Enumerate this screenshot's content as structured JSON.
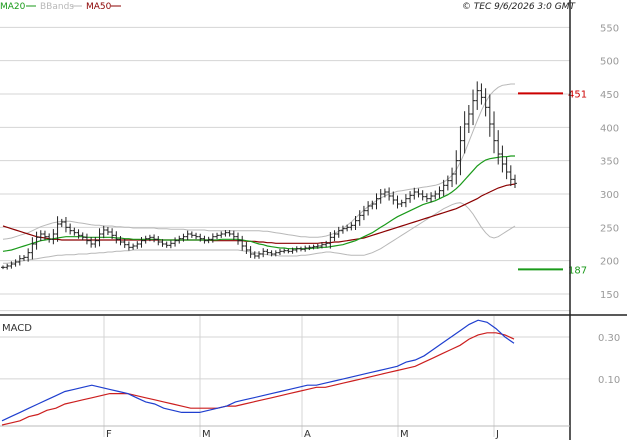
{
  "header": {
    "legend": [
      {
        "key": "ma20",
        "label": "MA20",
        "color": "#1a9a1a"
      },
      {
        "key": "bb",
        "label": "BBands",
        "color": "#b8b8b8"
      },
      {
        "key": "ma50",
        "label": "MA50",
        "color": "#8b0000"
      }
    ],
    "copyright": "© TEC 9/6/2026 3:0 GMT"
  },
  "colors": {
    "price": "#222222",
    "ma20": "#1a9a1a",
    "ma50": "#8b0000",
    "bb": "#b8b8b8",
    "grid": "#d4d4d4",
    "macd": "#1f3fcf",
    "signal": "#cc1f1f",
    "resistance": "#cc0000",
    "support": "#1a9a1a"
  },
  "chart_data": [
    {
      "type": "ohlc",
      "ylim": [
        120,
        570
      ],
      "yticks": [
        150,
        200,
        250,
        300,
        350,
        400,
        450,
        500,
        550
      ],
      "xlabels": [
        "F",
        "M",
        "A",
        "M",
        "J"
      ],
      "levels": [
        {
          "name": "resistance",
          "value": 451,
          "label": "451"
        },
        {
          "name": "support",
          "value": 187,
          "label": "187"
        }
      ],
      "closes": [
        190,
        192,
        195,
        198,
        203,
        205,
        212,
        225,
        235,
        240,
        236,
        232,
        240,
        255,
        258,
        250,
        245,
        242,
        238,
        235,
        230,
        225,
        230,
        240,
        246,
        243,
        238,
        232,
        228,
        224,
        220,
        222,
        225,
        230,
        233,
        235,
        232,
        228,
        225,
        223,
        226,
        230,
        233,
        236,
        240,
        238,
        236,
        233,
        230,
        232,
        236,
        238,
        240,
        242,
        240,
        236,
        230,
        222,
        216,
        210,
        207,
        210,
        214,
        212,
        210,
        212,
        214,
        215,
        214,
        216,
        218,
        217,
        219,
        220,
        221,
        222,
        224,
        226,
        235,
        240,
        245,
        248,
        250,
        253,
        260,
        268,
        275,
        282,
        285,
        293,
        300,
        303,
        297,
        291,
        285,
        287,
        293,
        298,
        303,
        300,
        296,
        293,
        297,
        300,
        305,
        313,
        320,
        330,
        350,
        380,
        405,
        420,
        440,
        455,
        445,
        430,
        405,
        380,
        360,
        345,
        333,
        322,
        316
      ],
      "ma20": [
        214,
        215,
        216,
        218,
        220,
        222,
        224,
        226,
        228,
        230,
        231,
        232,
        233,
        234,
        235,
        236,
        236,
        236,
        236,
        236,
        235,
        235,
        235,
        235,
        235,
        235,
        235,
        234,
        234,
        233,
        233,
        232,
        232,
        232,
        232,
        232,
        232,
        232,
        231,
        231,
        231,
        231,
        231,
        231,
        231,
        231,
        231,
        231,
        231,
        231,
        231,
        231,
        232,
        232,
        232,
        232,
        232,
        231,
        230,
        229,
        227,
        225,
        224,
        222,
        221,
        220,
        219,
        219,
        218,
        218,
        218,
        218,
        218,
        218,
        219,
        219,
        220,
        220,
        221,
        222,
        223,
        224,
        226,
        228,
        230,
        233,
        236,
        239,
        242,
        246,
        250,
        254,
        258,
        262,
        266,
        269,
        272,
        275,
        278,
        281,
        284,
        286,
        288,
        290,
        293,
        296,
        299,
        303,
        308,
        314,
        321,
        328,
        335,
        342,
        347,
        351,
        353,
        354,
        355,
        356,
        356,
        357,
        357
      ],
      "ma50": [
        252,
        250,
        248,
        246,
        244,
        242,
        240,
        238,
        236,
        235,
        234,
        233,
        232,
        232,
        231,
        231,
        231,
        231,
        231,
        231,
        231,
        231,
        231,
        231,
        231,
        231,
        231,
        231,
        231,
        231,
        231,
        231,
        231,
        231,
        231,
        231,
        231,
        231,
        231,
        231,
        231,
        231,
        231,
        231,
        231,
        231,
        231,
        231,
        231,
        231,
        230,
        230,
        230,
        230,
        230,
        230,
        230,
        230,
        229,
        229,
        229,
        228,
        228,
        227,
        227,
        226,
        226,
        226,
        226,
        226,
        226,
        226,
        226,
        226,
        226,
        226,
        227,
        227,
        227,
        228,
        228,
        229,
        230,
        231,
        232,
        233,
        234,
        236,
        238,
        240,
        242,
        244,
        246,
        248,
        250,
        252,
        254,
        256,
        258,
        260,
        262,
        264,
        266,
        268,
        270,
        272,
        274,
        276,
        278,
        281,
        284,
        287,
        290,
        293,
        297,
        300,
        303,
        306,
        309,
        311,
        313,
        314,
        315
      ],
      "bb_upper": [
        232,
        233,
        234,
        236,
        238,
        240,
        242,
        245,
        248,
        251,
        253,
        255,
        257,
        258,
        259,
        259,
        259,
        258,
        257,
        256,
        255,
        254,
        253,
        253,
        252,
        252,
        252,
        251,
        251,
        250,
        250,
        249,
        249,
        249,
        249,
        249,
        249,
        248,
        248,
        248,
        247,
        247,
        247,
        247,
        246,
        246,
        246,
        246,
        246,
        245,
        245,
        245,
        245,
        245,
        245,
        245,
        245,
        245,
        245,
        245,
        245,
        245,
        244,
        244,
        243,
        242,
        241,
        240,
        239,
        238,
        237,
        236,
        236,
        235,
        235,
        235,
        236,
        237,
        239,
        241,
        244,
        248,
        253,
        258,
        264,
        270,
        276,
        281,
        286,
        290,
        294,
        297,
        300,
        302,
        304,
        305,
        306,
        307,
        308,
        309,
        310,
        311,
        312,
        313,
        315,
        318,
        322,
        328,
        336,
        348,
        362,
        378,
        394,
        410,
        425,
        438,
        448,
        455,
        460,
        463,
        464,
        465,
        465
      ],
      "bb_lower": [
        196,
        196,
        197,
        198,
        199,
        200,
        201,
        202,
        203,
        204,
        205,
        206,
        207,
        208,
        208,
        209,
        209,
        209,
        210,
        210,
        210,
        211,
        211,
        212,
        212,
        213,
        213,
        214,
        214,
        215,
        215,
        216,
        216,
        216,
        216,
        216,
        216,
        216,
        216,
        216,
        216,
        216,
        216,
        216,
        216,
        216,
        216,
        216,
        216,
        216,
        216,
        216,
        216,
        216,
        216,
        216,
        216,
        215,
        214,
        213,
        212,
        211,
        210,
        209,
        208,
        208,
        207,
        207,
        207,
        207,
        207,
        208,
        208,
        209,
        210,
        211,
        212,
        213,
        213,
        212,
        211,
        210,
        209,
        208,
        208,
        208,
        208,
        210,
        212,
        215,
        218,
        222,
        226,
        230,
        234,
        238,
        242,
        246,
        250,
        254,
        258,
        262,
        266,
        270,
        274,
        278,
        281,
        284,
        286,
        287,
        284,
        278,
        270,
        260,
        250,
        242,
        236,
        234,
        236,
        240,
        244,
        248,
        252
      ]
    },
    {
      "type": "line",
      "title": "MACD",
      "ylim": [
        -12,
        40
      ],
      "yticks": [
        10,
        30
      ],
      "ytick_labels": [
        "0.10",
        "0.30"
      ],
      "series": [
        {
          "name": "macd",
          "values": [
            -10,
            -8,
            -6,
            -4,
            -2,
            0,
            2,
            4,
            5,
            6,
            7,
            6,
            5,
            4,
            3,
            1,
            -1,
            -2,
            -4,
            -5,
            -6,
            -6,
            -6,
            -5,
            -4,
            -3,
            -1,
            0,
            1,
            2,
            3,
            4,
            5,
            6,
            7,
            7,
            8,
            9,
            10,
            11,
            12,
            13,
            14,
            15,
            16,
            18,
            19,
            21,
            24,
            27,
            30,
            33,
            36,
            38,
            37,
            34,
            30,
            27
          ]
        },
        {
          "name": "signal",
          "values": [
            -12,
            -11,
            -10,
            -8,
            -7,
            -5,
            -4,
            -2,
            -1,
            0,
            1,
            2,
            3,
            3,
            3,
            2,
            1,
            0,
            -1,
            -2,
            -3,
            -4,
            -4,
            -4,
            -4,
            -3,
            -3,
            -2,
            -1,
            0,
            1,
            2,
            3,
            4,
            5,
            6,
            6,
            7,
            8,
            9,
            10,
            11,
            12,
            13,
            14,
            15,
            16,
            18,
            20,
            22,
            24,
            26,
            29,
            31,
            32,
            32,
            31,
            29
          ]
        }
      ]
    }
  ]
}
